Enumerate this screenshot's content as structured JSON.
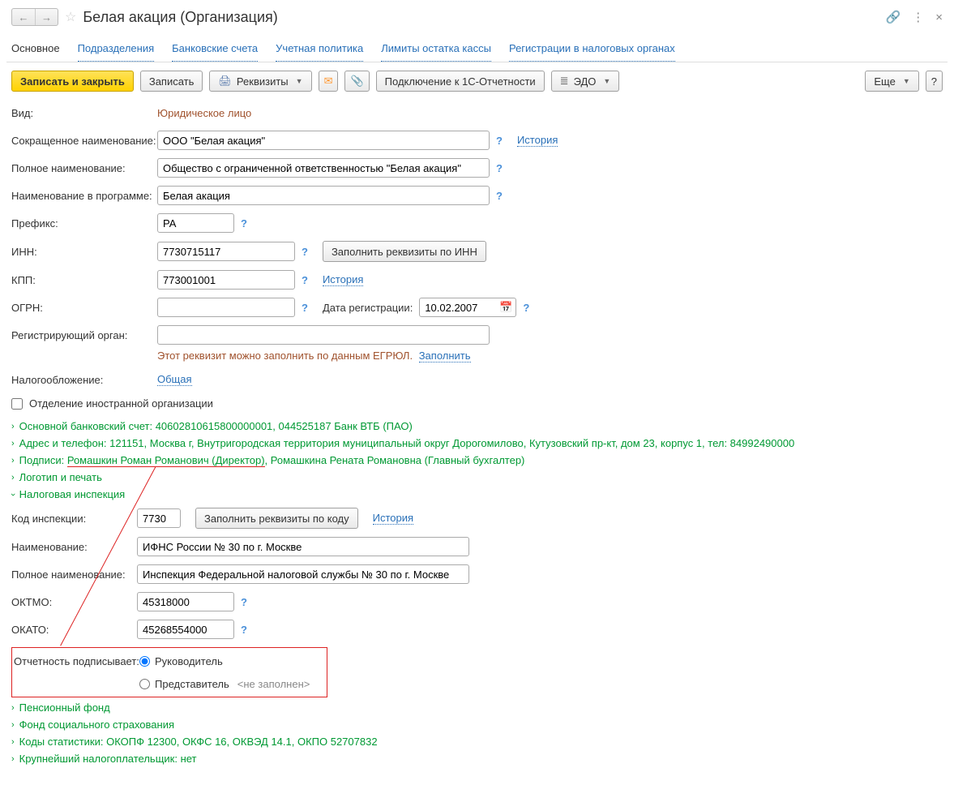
{
  "title": "Белая акация (Организация)",
  "tabs": {
    "main": "Основное",
    "divisions": "Подразделения",
    "bank": "Банковские счета",
    "policy": "Учетная политика",
    "cash": "Лимиты остатка кассы",
    "tax_reg": "Регистрации в налоговых органах"
  },
  "toolbar": {
    "save_close": "Записать и закрыть",
    "save": "Записать",
    "requisites": "Реквизиты",
    "connect": "Подключение к 1С-Отчетности",
    "edo": "ЭДО",
    "more": "Еще"
  },
  "labels": {
    "kind": "Вид:",
    "short_name": "Сокращенное наименование:",
    "full_name": "Полное наименование:",
    "prog_name": "Наименование в программе:",
    "prefix": "Префикс:",
    "inn": "ИНН:",
    "kpp": "КПП:",
    "ogrn": "ОГРН:",
    "reg_date": "Дата регистрации:",
    "reg_organ": "Регистрирующий орган:",
    "tax": "Налогообложение:",
    "foreign": "Отделение иностранной организации",
    "insp_code": "Код инспекции:",
    "insp_name": "Наименование:",
    "insp_full": "Полное наименование:",
    "oktmo": "ОКТМО:",
    "okato": "ОКАТО:",
    "signer": "Отчетность подписывает:"
  },
  "values": {
    "kind": "Юридическое лицо",
    "short_name": "ООО \"Белая акация\"",
    "full_name": "Общество с ограниченной ответственностью \"Белая акация\"",
    "prog_name": "Белая акация",
    "prefix": "РА",
    "inn": "7730715117",
    "kpp": "773001001",
    "ogrn": "",
    "reg_date": "10.02.2007",
    "reg_organ": "",
    "tax": "Общая",
    "insp_code": "7730",
    "insp_name": "ИФНС России № 30 по г. Москве",
    "insp_full": "Инспекция Федеральной налоговой службы № 30 по г. Москве",
    "oktmo": "45318000",
    "okato": "45268554000"
  },
  "buttons": {
    "fill_inn": "Заполнить реквизиты по ИНН",
    "fill_code": "Заполнить реквизиты по коду"
  },
  "links": {
    "history": "История",
    "fill": "Заполнить"
  },
  "hints": {
    "reg_organ": "Этот реквизит можно заполнить по данным ЕГРЮЛ."
  },
  "expanders": {
    "bank": "Основной банковский счет: 40602810615800000001, 044525187 Банк ВТБ (ПАО)",
    "address": "Адрес и телефон: 121151, Москва г, Внутригородская территория муниципальный округ Дорогомилово, Кутузовский пр-кт, дом 23, корпус 1, тел: 84992490000",
    "sign_pre": "Подписи: ",
    "sign_u": "Ромашкин Роман Романович (Директор)",
    "sign_post": ", Ромашкина Рената Романовна (Главный бухгалтер)",
    "logo": "Логотип и печать",
    "tax_insp": "Налоговая инспекция",
    "pension": "Пенсионный фонд",
    "fss": "Фонд социального страхования",
    "codes": "Коды статистики: ОКОПФ 12300, ОКФС 16, ОКВЭД 14.1, ОКПО 52707832",
    "largest": "Крупнейший налогоплательщик: нет"
  },
  "radio": {
    "head": "Руководитель",
    "rep": "Представитель",
    "rep_empty": "<не заполнен>"
  }
}
